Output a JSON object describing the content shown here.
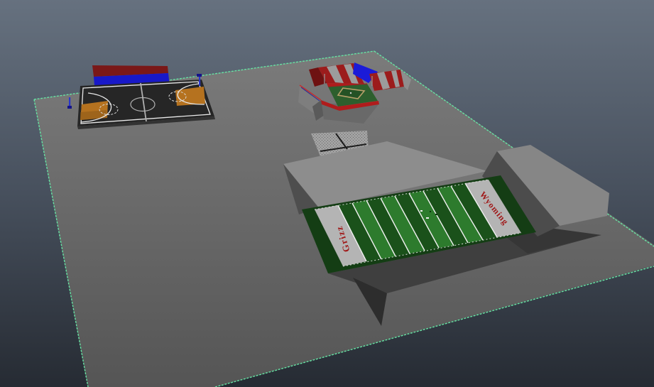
{
  "scene": {
    "title": "3D viewport - sports complex scene",
    "selection_outline_color": "#66e2a3",
    "background_top": "#66717f",
    "background_mid": "#47505d",
    "background_bottom": "#262b33",
    "ground_top": "#7b7b7b",
    "ground_bottom": "#555555"
  },
  "objects": {
    "basketball": {
      "name": "basketball-court",
      "court_color": "#262626",
      "key_orange": "#b5721f",
      "bleacher_red": "#7a1818",
      "bleacher_blue": "#1818c8",
      "line_white": "#e8e8e8"
    },
    "baseball": {
      "name": "baseball-stadium",
      "field_green": "#2d5f2d",
      "infield_green": "#255225",
      "wall_red": "#b01c1c",
      "stand_red": "#9c1c1c",
      "stand_gray": "#9c9c9c",
      "screen_blue": "#1b1bd8",
      "basepath_tan": "#b8a06a"
    },
    "tennis": {
      "name": "tennis-court",
      "surface_gray": "#a2a2a2",
      "line_dark": "#1c1c1c"
    },
    "football": {
      "name": "football-stadium",
      "endzone_left_label": "Grizz",
      "endzone_right_label": "Wyoming",
      "label_color": "#a01818",
      "stripe_dark": "#1a511a",
      "stripe_light": "#2d7b2d",
      "endzone_gray": "#b4b4b4",
      "border_green": "#143d14",
      "yard_line": "#f0f0f0",
      "deck_gray": "#8d8d8d",
      "stand_gray": "#868686"
    }
  }
}
